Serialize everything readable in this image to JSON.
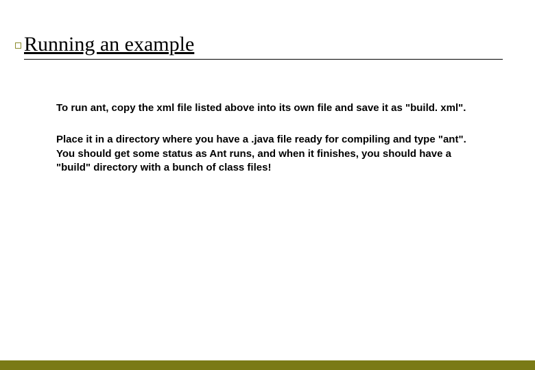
{
  "slide": {
    "title": "Running an example",
    "paragraphs": [
      "To run ant, copy the xml file listed above into its own file and save it as \"build. xml\".",
      "Place it in a directory where you have a .java file ready for compiling and type \"ant\". You should get some status as Ant runs, and when it finishes, you should have a \"build\" directory with a bunch of class files!"
    ]
  }
}
